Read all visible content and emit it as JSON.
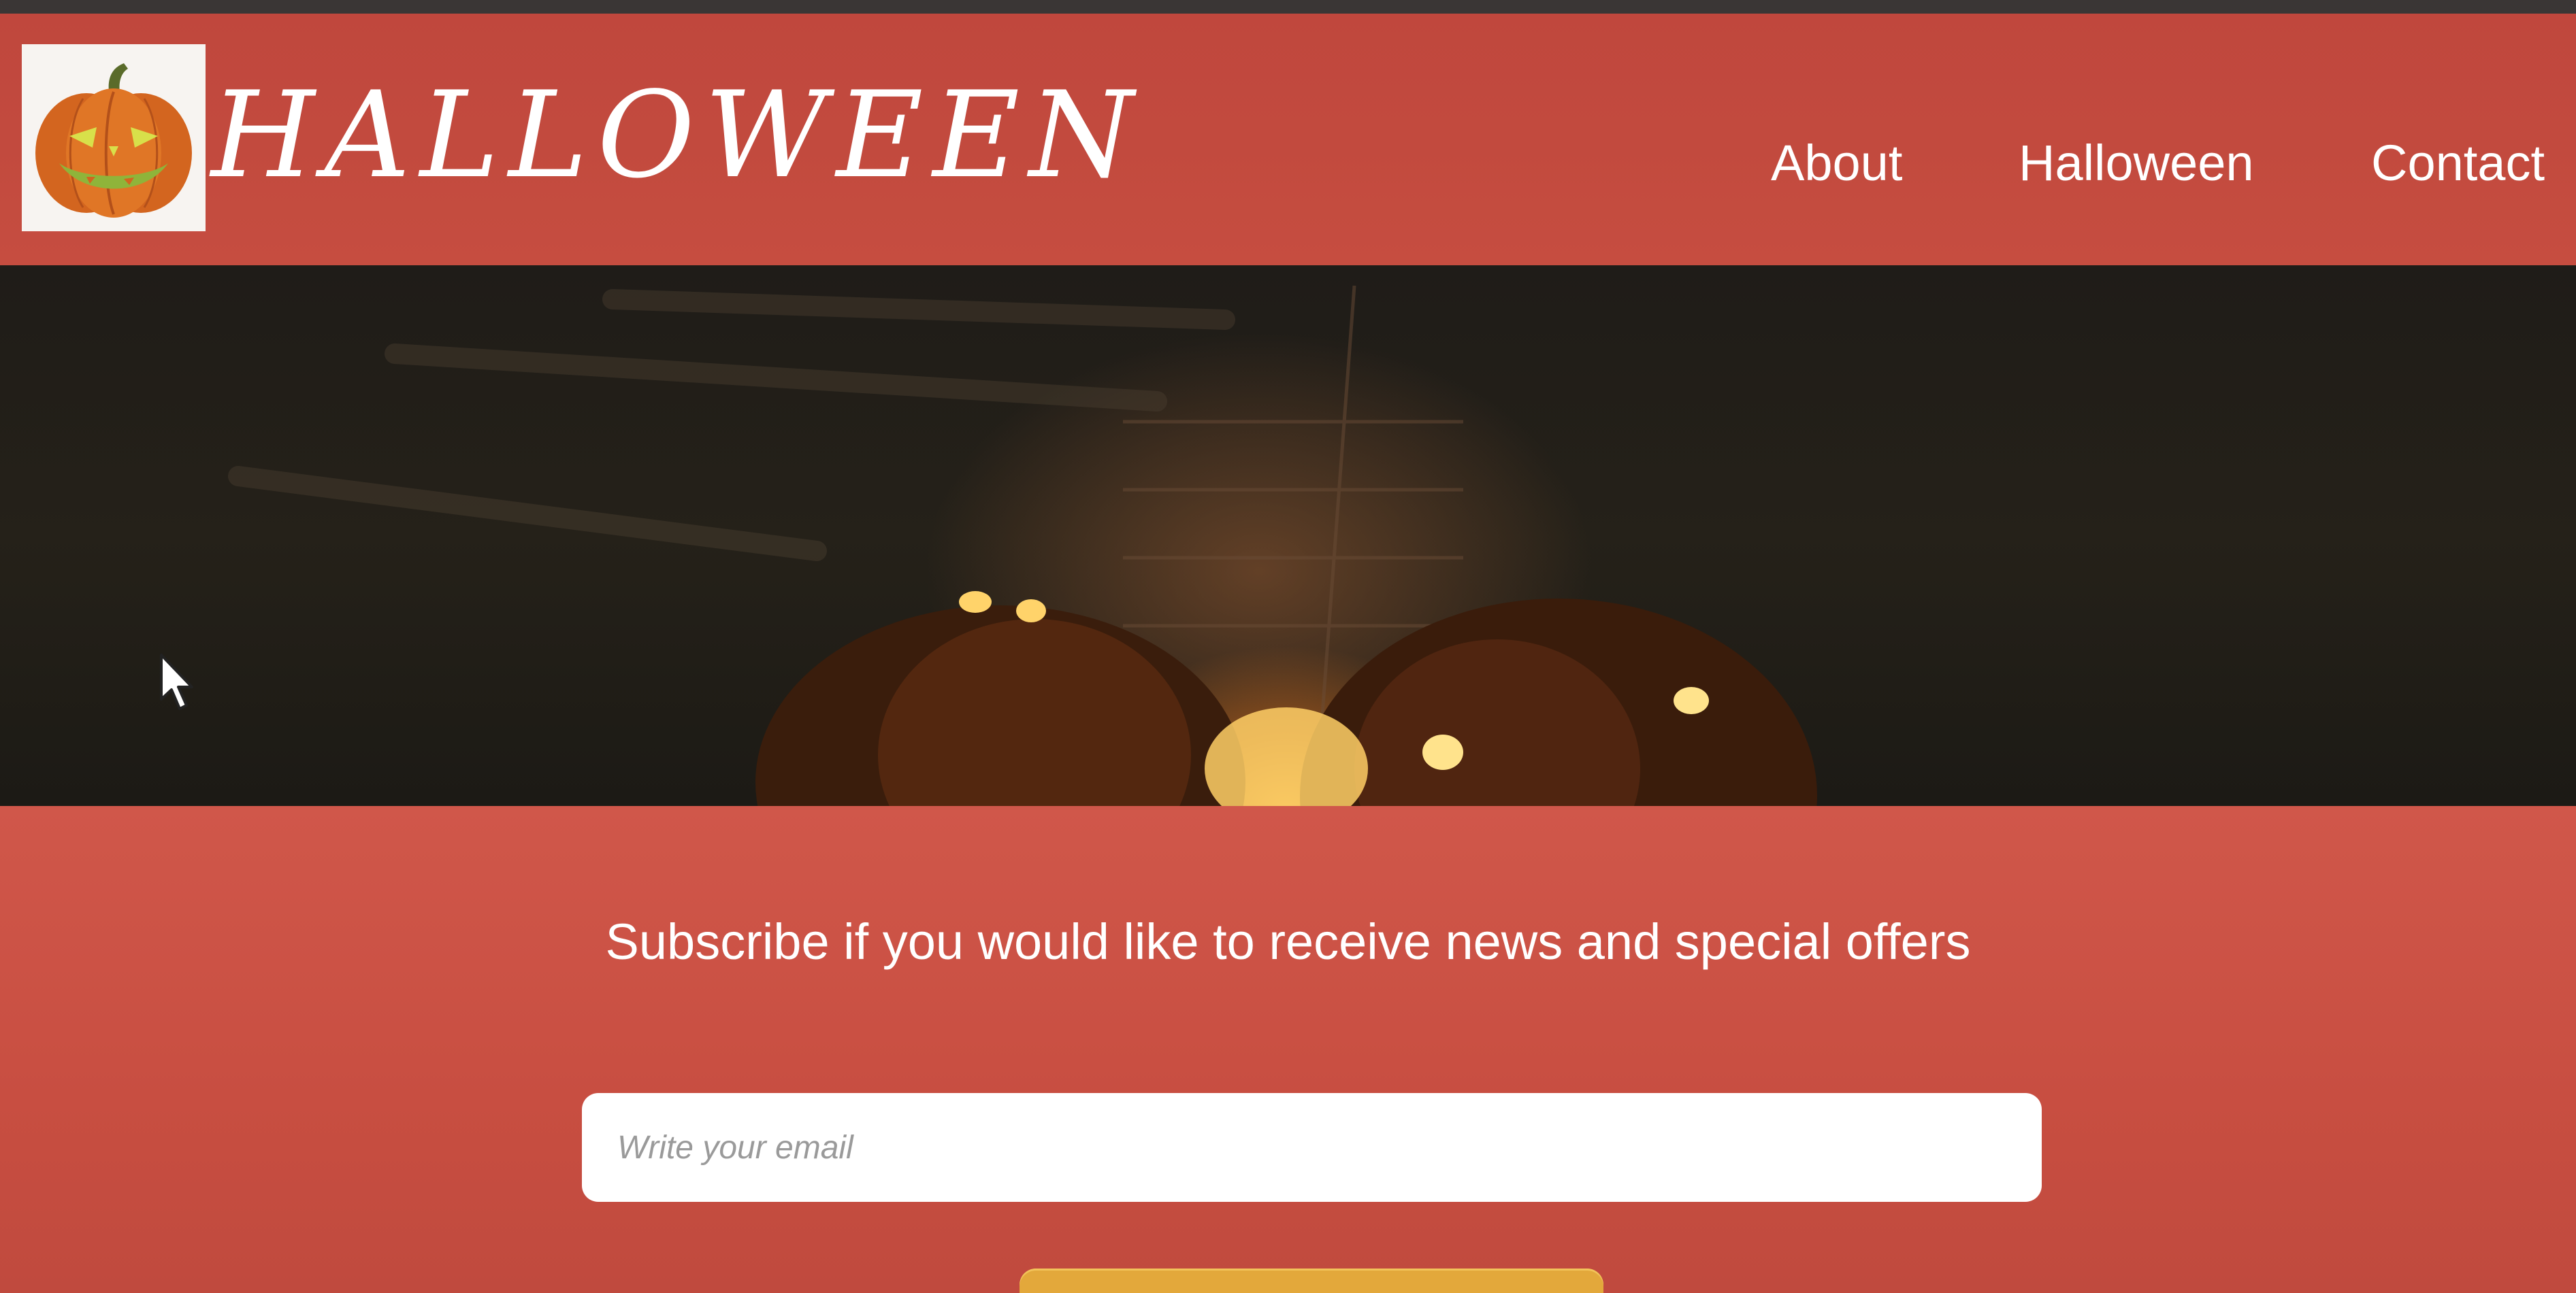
{
  "header": {
    "brand_title": "HALLOWEEN",
    "logo_icon": "jack-o-lantern-icon",
    "nav": [
      {
        "label": "About"
      },
      {
        "label": "Halloween"
      },
      {
        "label": "Contact"
      }
    ]
  },
  "hero": {
    "image": "glowing-jack-o-lanterns-photo"
  },
  "subscribe": {
    "heading": "Subscribe if you would like to receive news and special offers",
    "email_placeholder": "Write your email",
    "button_label": ""
  },
  "colors": {
    "header_bg": "#c24a3e",
    "section_bg": "#c84e41",
    "button_bg": "#e3a83b",
    "text": "#ffffff"
  }
}
